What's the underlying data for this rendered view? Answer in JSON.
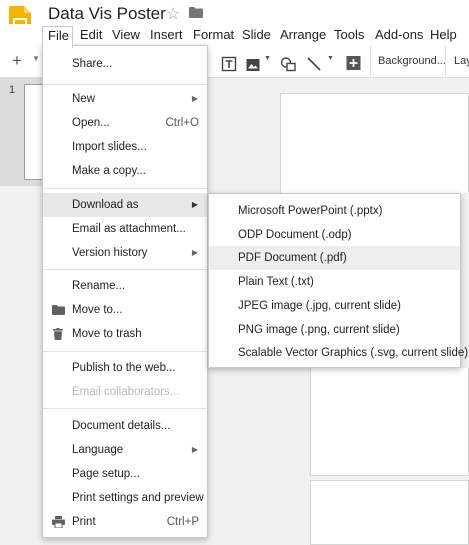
{
  "app": {
    "title": "Data Vis Poster",
    "logo_icon": "slides-logo-icon",
    "logo_color": "#f4b400"
  },
  "menubar": {
    "items": [
      "File",
      "Edit",
      "View",
      "Insert",
      "Format",
      "Slide",
      "Arrange",
      "Tools",
      "Add-ons",
      "Help"
    ]
  },
  "toolbar": {
    "add_label": "+",
    "background_label": "Background...",
    "layout_label": "Lay"
  },
  "filmstrip": {
    "slide_number": "1"
  },
  "file_menu": {
    "share": "Share...",
    "new": "New",
    "open": "Open...",
    "open_shortcut": "Ctrl+O",
    "import_slides": "Import slides...",
    "make_copy": "Make a copy...",
    "download_as": "Download as",
    "email_attachment": "Email as attachment...",
    "version_history": "Version history",
    "rename": "Rename...",
    "move_to": "Move to...",
    "move_to_trash": "Move to trash",
    "publish": "Publish to the web...",
    "email_collaborators": "Email collaborators...",
    "document_details": "Document details...",
    "language": "Language",
    "page_setup": "Page setup...",
    "print_settings": "Print settings and preview",
    "print": "Print",
    "print_shortcut": "Ctrl+P"
  },
  "download_submenu": {
    "items": [
      "Microsoft PowerPoint (.pptx)",
      "ODP Document (.odp)",
      "PDF Document (.pdf)",
      "Plain Text (.txt)",
      "JPEG image (.jpg, current slide)",
      "PNG image (.png, current slide)",
      "Scalable Vector Graphics (.svg, current slide)"
    ],
    "highlighted": "PDF Document (.pdf)"
  },
  "colors": {
    "menu_hover": "#e8e8e8",
    "disabled_text": "#b8b8b8",
    "chrome_bg": "#f1f1f1"
  }
}
